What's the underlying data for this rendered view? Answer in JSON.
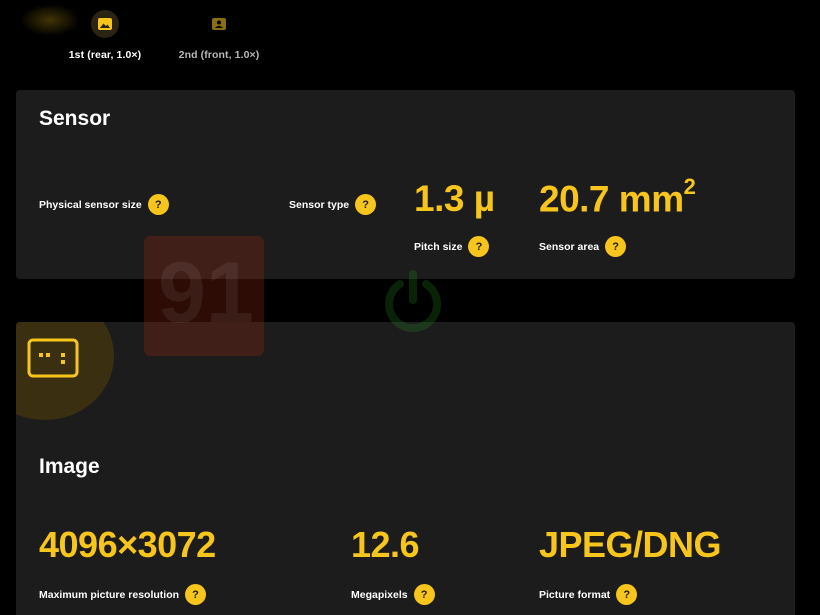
{
  "tabs": [
    {
      "label": "1st (rear, 1.0×)",
      "icon": "camera-rear-icon",
      "active": true
    },
    {
      "label": "2nd (front, 1.0×)",
      "icon": "camera-front-icon",
      "active": false
    }
  ],
  "help_glyph": "?",
  "sensor": {
    "title": "Sensor",
    "physical_size_label": "Physical sensor size",
    "type_label": "Sensor type",
    "pitch_value": "1.3 µ",
    "pitch_label": "Pitch size",
    "area_value": "20.7 mm",
    "area_sup": "2",
    "area_label": "Sensor area"
  },
  "image": {
    "title": "Image",
    "icon": "image-resolution-icon",
    "resolution_value": "4096×3072",
    "resolution_label": "Maximum picture resolution",
    "megapixels_value": "12.6",
    "megapixels_label": "Megapixels",
    "format_value": "JPEG/DNG",
    "format_label": "Picture format"
  },
  "watermark": {
    "number": "91"
  },
  "colors": {
    "accent": "#f7c51c",
    "card_bg": "#1c1c1c",
    "page_bg": "#000000"
  }
}
